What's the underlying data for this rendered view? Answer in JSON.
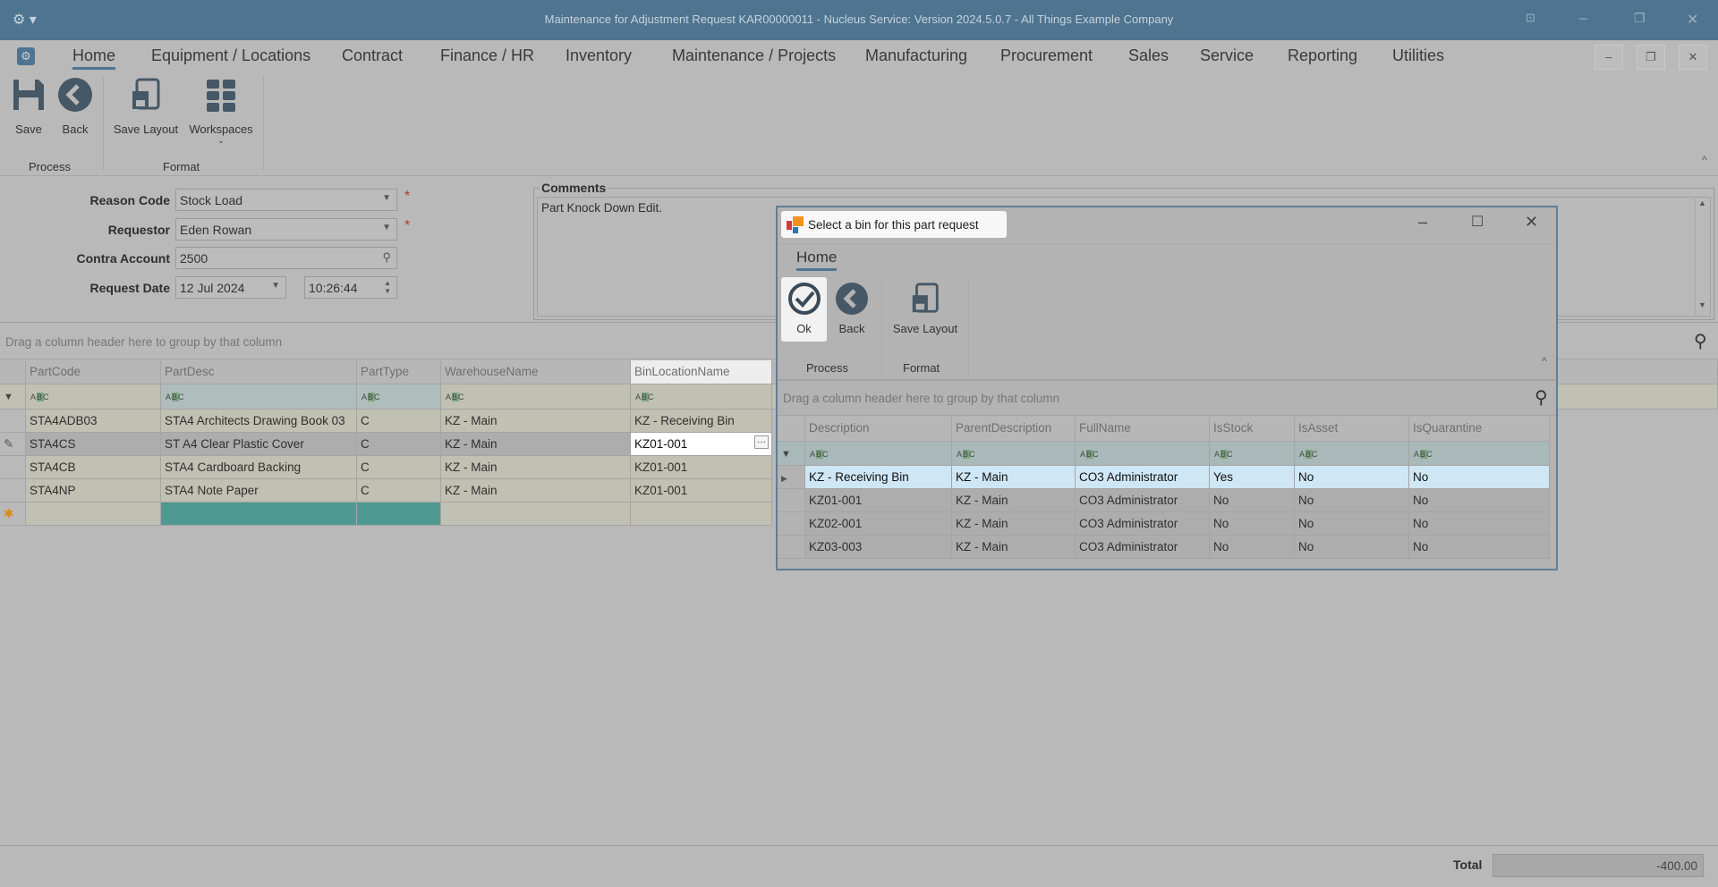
{
  "window": {
    "title": "Maintenance for Adjustment Request KAR00000011 - Nucleus Service: Version 2024.5.0.7 - All Things Example Company"
  },
  "menu": {
    "tabs": [
      "Home",
      "Equipment / Locations",
      "Contract",
      "Finance / HR",
      "Inventory",
      "Maintenance / Projects",
      "Manufacturing",
      "Procurement",
      "Sales",
      "Service",
      "Reporting",
      "Utilities"
    ]
  },
  "ribbon": {
    "save": "Save",
    "back": "Back",
    "save_layout": "Save Layout",
    "workspaces": "Workspaces",
    "group_process": "Process",
    "group_format": "Format"
  },
  "form": {
    "reason_code_label": "Reason Code",
    "reason_code": "Stock Load",
    "requestor_label": "Requestor",
    "requestor": "Eden Rowan",
    "contra_label": "Contra Account",
    "contra": "2500",
    "date_label": "Request Date",
    "date": "12 Jul 2024",
    "time": "10:26:44",
    "comments_label": "Comments",
    "comments": "Part Knock Down Edit."
  },
  "grid": {
    "group_hint": "Drag a column header here to group by that column",
    "columns": [
      "PartCode",
      "PartDesc",
      "PartType",
      "WarehouseName",
      "BinLocationName"
    ],
    "filter": "ABC",
    "rows": [
      [
        "STA4ADB03",
        "STA4 Architects Drawing Book 03",
        "C",
        "KZ - Main",
        "KZ - Receiving Bin"
      ],
      [
        "STA4CS",
        "ST A4 Clear Plastic Cover",
        "C",
        "KZ - Main",
        "KZ01-001"
      ],
      [
        "STA4CB",
        "STA4 Cardboard Backing",
        "C",
        "KZ - Main",
        "KZ01-001"
      ],
      [
        "STA4NP",
        "STA4 Note Paper",
        "C",
        "KZ - Main",
        "KZ01-001"
      ]
    ]
  },
  "footer": {
    "total_label": "Total",
    "total": "-400.00"
  },
  "dialog": {
    "title": "Select a bin for this part request",
    "tab": "Home",
    "ok": "Ok",
    "back": "Back",
    "save_layout": "Save Layout",
    "group_process": "Process",
    "group_format": "Format",
    "group_hint": "Drag a column header here to group by that column",
    "columns": [
      "Description",
      "ParentDescription",
      "FullName",
      "IsStock",
      "IsAsset",
      "IsQuarantine"
    ],
    "rows": [
      [
        "KZ - Receiving Bin",
        "KZ - Main",
        "CO3 Administrator",
        "Yes",
        "No",
        "No"
      ],
      [
        "KZ01-001",
        "KZ - Main",
        "CO3 Administrator",
        "No",
        "No",
        "No"
      ],
      [
        "KZ02-001",
        "KZ - Main",
        "CO3 Administrator",
        "No",
        "No",
        "No"
      ],
      [
        "KZ03-003",
        "KZ - Main",
        "CO3 Administrator",
        "No",
        "No",
        "No"
      ]
    ]
  },
  "colors": {
    "titlebar": "#4e7490",
    "selected_row": "#cfe6f5",
    "teal": "#4e9a92"
  }
}
